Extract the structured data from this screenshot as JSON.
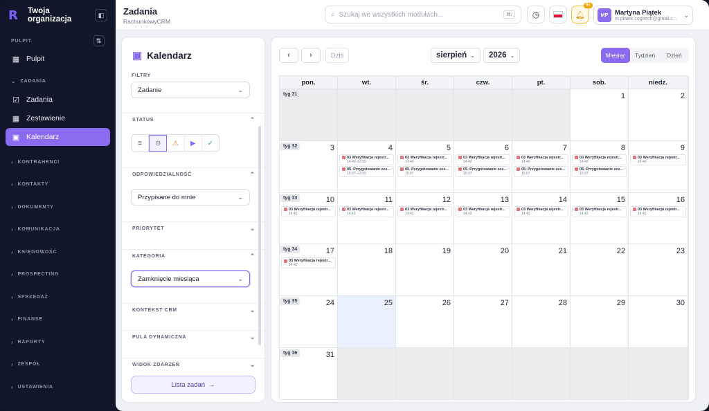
{
  "sidebar": {
    "org_name": "Twoja organizacja",
    "sections": [
      {
        "label": "PULPIT",
        "items": [
          {
            "label": "Pulpit",
            "icon": "grid-icon"
          }
        ]
      },
      {
        "label": "ZADANIA",
        "items": [
          {
            "label": "Zadania",
            "icon": "check-square-icon"
          },
          {
            "label": "Zestawienie",
            "icon": "grid-icon"
          },
          {
            "label": "Kalendarz",
            "icon": "calendar-icon",
            "active": true
          }
        ]
      }
    ],
    "groups": [
      "KONTRAHENCI",
      "KONTAKTY",
      "DOKUMENTY",
      "KOMUNIKACJA",
      "KSIĘGOWOŚĆ",
      "PROSPECTING",
      "SPRZEDAŻ",
      "FINANSE",
      "RAPORTY",
      "ZESPÓŁ",
      "USTAWIENIA"
    ]
  },
  "header": {
    "title": "Zadania",
    "subtitle": "RachunkowyCRM",
    "search_placeholder": "Szukaj we wszystkich modułach...",
    "search_shortcut": "⌘/",
    "notif_badge": "9+",
    "user": {
      "initials": "MP",
      "name": "Martyna Piątek",
      "email": "m.piatek.cogitech@gmail.c..."
    }
  },
  "filters": {
    "title": "Kalendarz",
    "filtry_label": "FILTRY",
    "filtry_value": "Zadanie",
    "status_label": "STATUS",
    "odp_label": "ODPOWIEDZIALNOŚĆ",
    "odp_value": "Przypisane do mnie",
    "priorytet_label": "PRIORYTET",
    "kategoria_label": "KATEGORIA",
    "kategoria_value": "Zamknięcie miesiąca",
    "kontekst_label": "KONTEKST CRM",
    "pula_label": "PULA DYNAMICZNA",
    "widok_label": "WIDOK ZDARZEŃ",
    "task_list_button": "Lista zadań"
  },
  "calendar": {
    "today_label": "Dziś",
    "month": "sierpień",
    "year": "2026",
    "views": [
      "Miesiąc",
      "Tydzień",
      "Dzień"
    ],
    "active_view": "Miesiąc",
    "weekdays": [
      "pon.",
      "wt.",
      "śr.",
      "czw.",
      "pt.",
      "sob.",
      "niedz."
    ],
    "weeks": [
      {
        "label": "tyg 31",
        "days": [
          {
            "n": "",
            "out": true
          },
          {
            "n": "",
            "out": true
          },
          {
            "n": "",
            "out": true
          },
          {
            "n": "",
            "out": true
          },
          {
            "n": "",
            "out": true
          },
          {
            "n": "1"
          },
          {
            "n": "2"
          }
        ]
      },
      {
        "label": "tyg 32",
        "days": [
          {
            "n": "3"
          },
          {
            "n": "4",
            "events": [
              {
                "t": "03 Weryfikacja rejestr...",
                "tm": "14:42–23:59"
              },
              {
                "t": "05. Przygotowanie zes...",
                "tm": "15:07–23:59"
              }
            ]
          },
          {
            "n": "5",
            "events": [
              {
                "t": "03 Weryfikacja rejestr...",
                "tm": "14:42"
              },
              {
                "t": "05. Przygotowanie zes...",
                "tm": "15:07"
              }
            ]
          },
          {
            "n": "6",
            "events": [
              {
                "t": "03 Weryfikacja rejestr...",
                "tm": "14:42"
              },
              {
                "t": "05. Przygotowanie zes...",
                "tm": "15:07"
              }
            ]
          },
          {
            "n": "7",
            "events": [
              {
                "t": "03 Weryfikacja rejestr...",
                "tm": "14:42"
              },
              {
                "t": "05. Przygotowanie zes...",
                "tm": "15:07"
              }
            ]
          },
          {
            "n": "8",
            "events": [
              {
                "t": "03 Weryfikacja rejestr...",
                "tm": "14:42"
              },
              {
                "t": "05. Przygotowanie zes...",
                "tm": "15:07"
              }
            ]
          },
          {
            "n": "9",
            "events": [
              {
                "t": "03 Weryfikacja rejestr...",
                "tm": "14:42"
              }
            ]
          }
        ]
      },
      {
        "label": "tyg 33",
        "days": [
          {
            "n": "10",
            "events": [
              {
                "t": "03 Weryfikacja rejestr...",
                "tm": "14:42"
              }
            ]
          },
          {
            "n": "11",
            "events": [
              {
                "t": "03 Weryfikacja rejestr...",
                "tm": "14:42"
              }
            ]
          },
          {
            "n": "12",
            "events": [
              {
                "t": "03 Weryfikacja rejestr...",
                "tm": "14:42"
              }
            ]
          },
          {
            "n": "13",
            "events": [
              {
                "t": "03 Weryfikacja rejestr...",
                "tm": "14:42"
              }
            ]
          },
          {
            "n": "14",
            "events": [
              {
                "t": "03 Weryfikacja rejestr...",
                "tm": "14:42"
              }
            ]
          },
          {
            "n": "15",
            "events": [
              {
                "t": "03 Weryfikacja rejestr...",
                "tm": "14:42"
              }
            ]
          },
          {
            "n": "16",
            "events": [
              {
                "t": "03 Weryfikacja rejestr...",
                "tm": "14:42"
              }
            ]
          }
        ]
      },
      {
        "label": "tyg 34",
        "days": [
          {
            "n": "17",
            "events": [
              {
                "t": "03 Weryfikacja rejestr...",
                "tm": "14:42"
              }
            ]
          },
          {
            "n": "18"
          },
          {
            "n": "19"
          },
          {
            "n": "20"
          },
          {
            "n": "21"
          },
          {
            "n": "22"
          },
          {
            "n": "23"
          }
        ]
      },
      {
        "label": "tyg 35",
        "days": [
          {
            "n": "24"
          },
          {
            "n": "25",
            "today": true
          },
          {
            "n": "26"
          },
          {
            "n": "27"
          },
          {
            "n": "28"
          },
          {
            "n": "29"
          },
          {
            "n": "30"
          }
        ]
      },
      {
        "label": "tyg 36",
        "days": [
          {
            "n": "31"
          },
          {
            "n": "",
            "out": true
          },
          {
            "n": "",
            "out": true
          },
          {
            "n": "",
            "out": true
          },
          {
            "n": "",
            "out": true
          },
          {
            "n": "",
            "out": true
          },
          {
            "n": "",
            "out": true
          }
        ]
      }
    ]
  }
}
